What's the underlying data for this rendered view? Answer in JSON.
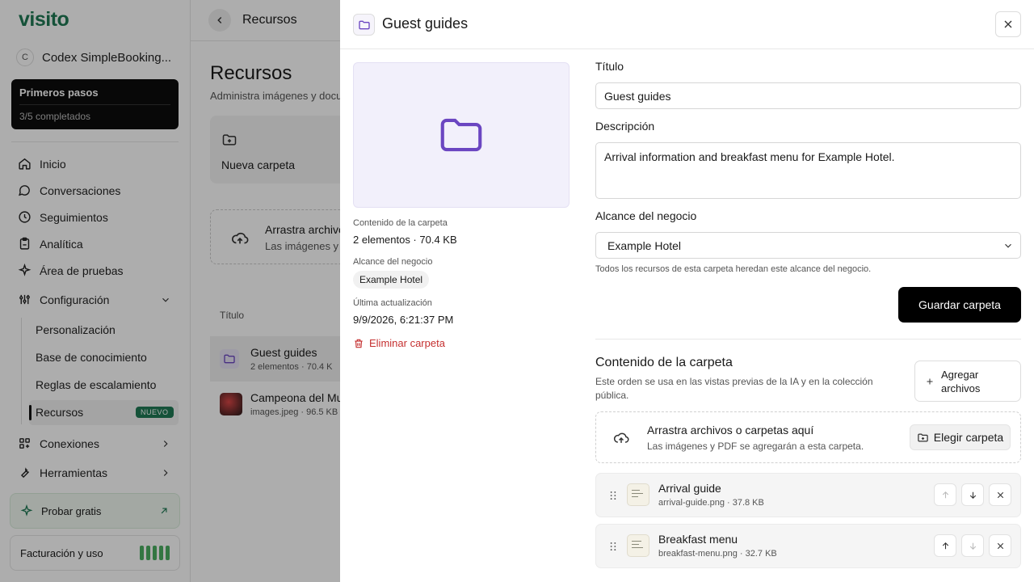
{
  "sidebar": {
    "logo": "visito",
    "workspace": {
      "initial": "C",
      "name": "Codex SimpleBooking..."
    },
    "onboarding": {
      "title": "Primeros pasos",
      "progress": "3/5 completados"
    },
    "nav": [
      {
        "label": "Inicio",
        "icon": "home-icon"
      },
      {
        "label": "Conversaciones",
        "icon": "chat-icon"
      },
      {
        "label": "Seguimientos",
        "icon": "clock-icon"
      },
      {
        "label": "Analítica",
        "icon": "clipboard-icon"
      },
      {
        "label": "Área de pruebas",
        "icon": "sparkle-icon"
      },
      {
        "label": "Configuración",
        "icon": "sliders-icon"
      }
    ],
    "subnav": [
      "Personalización",
      "Base de conocimiento",
      "Reglas de escalamiento",
      "Recursos"
    ],
    "new_badge": "NUEVO",
    "nav2": [
      {
        "label": "Conexiones",
        "icon": "grid-icon"
      },
      {
        "label": "Herramientas",
        "icon": "wrench-icon"
      }
    ],
    "trial": "Probar gratis",
    "billing": "Facturación y uso"
  },
  "main": {
    "breadcrumb": "Recursos",
    "title": "Recursos",
    "subtitle": "Administra imágenes y docu",
    "new_folder": "Nueva carpeta",
    "drop_title": "Arrastra archivo",
    "drop_sub": "Las imágenes y l",
    "col_title": "Título",
    "rows": [
      {
        "name": "Guest guides",
        "meta": "2 elementos · 70.4 K"
      },
      {
        "name": "Campeona del Mu",
        "meta": "images.jpeg · 96.5 KB"
      }
    ]
  },
  "panel": {
    "title": "Guest guides",
    "content_label": "Contenido de la carpeta",
    "content_value": "2 elementos · 70.4 KB",
    "scope_label": "Alcance del negocio",
    "scope_value": "Example Hotel",
    "updated_label": "Última actualización",
    "updated_value": "9/9/2026, 6:21:37 PM",
    "delete": "Eliminar carpeta",
    "form": {
      "title_label": "Título",
      "title_value": "Guest guides",
      "desc_label": "Descripción",
      "desc_value": "Arrival information and breakfast menu for Example Hotel.",
      "scope_label": "Alcance del negocio",
      "scope_value": "Example Hotel",
      "scope_help": "Todos los recursos de esta carpeta heredan este alcance del negocio.",
      "save": "Guardar carpeta"
    },
    "contents": {
      "title": "Contenido de la carpeta",
      "desc": "Este orden se usa en las vistas previas de la IA y en la colección pública.",
      "add_line1": "Agregar",
      "add_line2": "archivos",
      "drop_title": "Arrastra archivos o carpetas aquí",
      "drop_sub": "Las imágenes y PDF se agregarán a esta carpeta.",
      "choose": "Elegir carpeta",
      "files": [
        {
          "name": "Arrival guide",
          "meta": "arrival-guide.png · 37.8 KB"
        },
        {
          "name": "Breakfast menu",
          "meta": "breakfast-menu.png · 32.7 KB"
        }
      ]
    }
  },
  "colors": {
    "brand": "#1f7a55",
    "folder": "#6b46c1",
    "danger": "#c53030"
  }
}
